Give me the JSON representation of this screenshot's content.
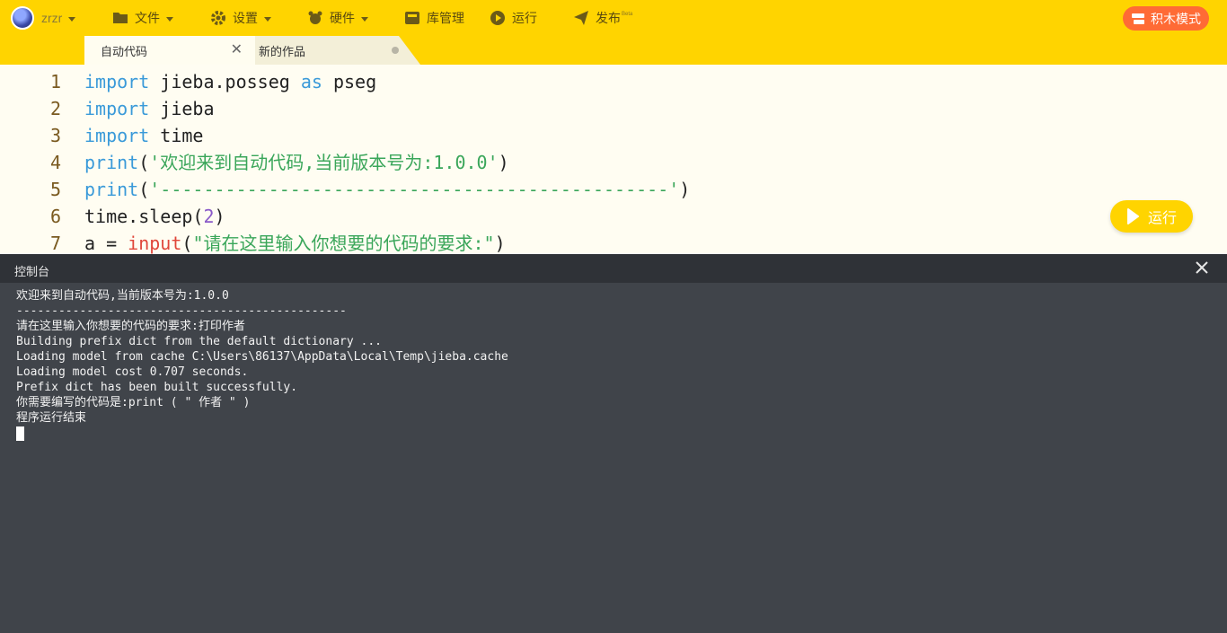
{
  "topbar": {
    "username": "zrzr",
    "menu": [
      {
        "label": "文件",
        "icon": "folder-icon"
      },
      {
        "label": "设置",
        "icon": "gear-icon"
      },
      {
        "label": "硬件",
        "icon": "hardware-icon"
      },
      {
        "label": "库管理",
        "icon": "library-icon"
      },
      {
        "label": "运行",
        "icon": "play-icon"
      },
      {
        "label": "发布",
        "icon": "send-icon",
        "badge": "Beta"
      }
    ],
    "block_mode_label": "积木模式",
    "accent": "#ffd400",
    "block_mode_color": "#ff6b35"
  },
  "tabs": [
    {
      "label": "自动代码",
      "active": true
    },
    {
      "label": "新的作品",
      "active": false
    }
  ],
  "editor": {
    "line_numbers": [
      "1",
      "2",
      "3",
      "4",
      "5",
      "6",
      "7"
    ],
    "lines": [
      [
        "import",
        " jieba.posseg ",
        "as",
        " pseg"
      ],
      [
        "import",
        " jieba"
      ],
      [
        "import",
        " time"
      ],
      [
        "print",
        "(",
        "'欢迎来到自动代码,当前版本号为:1.0.0'",
        ")"
      ],
      [
        "print",
        "(",
        "'-----------------------------------------------'",
        ")"
      ],
      [
        "time.sleep(",
        "2",
        ")"
      ],
      [
        "a = ",
        "input",
        "(",
        "\"请在这里输入你想要的代码的要求:\"",
        ")"
      ]
    ],
    "run_label": "运行"
  },
  "console": {
    "title": "控制台",
    "output": [
      "欢迎来到自动代码,当前版本号为:1.0.0",
      "-----------------------------------------------",
      "请在这里输入你想要的代码的要求:打印作者",
      "Building prefix dict from the default dictionary ...",
      "Loading model from cache C:\\Users\\86137\\AppData\\Local\\Temp\\jieba.cache",
      "Loading model cost 0.707 seconds.",
      "Prefix dict has been built successfully.",
      "你需要编写的代码是:print ( \" 作者 \" )",
      "程序运行结束"
    ]
  }
}
